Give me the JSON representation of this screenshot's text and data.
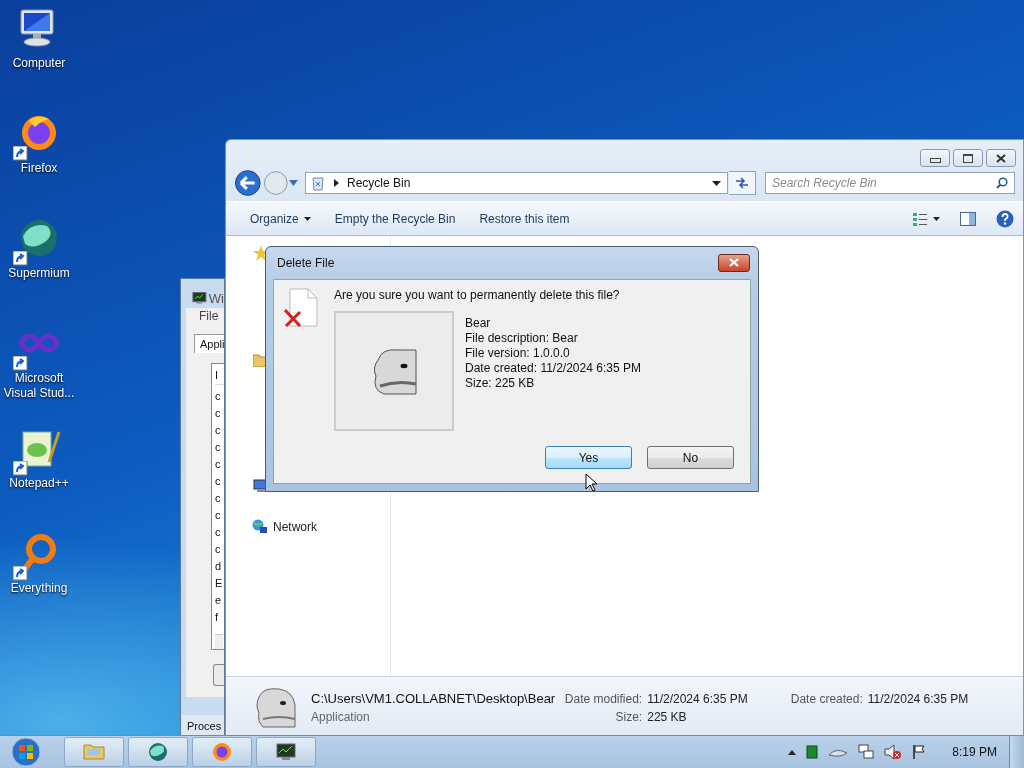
{
  "desktop_icons": [
    {
      "label": "Computer",
      "kind": "computer",
      "shortcut": false
    },
    {
      "label": "Firefox",
      "kind": "firefox",
      "shortcut": true
    },
    {
      "label": "Supermium",
      "kind": "supermium",
      "shortcut": true
    },
    {
      "label": "Microsoft Visual Stud...",
      "kind": "visualstudio",
      "shortcut": true
    },
    {
      "label": "Notepad++",
      "kind": "notepad",
      "shortcut": true
    },
    {
      "label": "Everything",
      "kind": "everything",
      "shortcut": true
    }
  ],
  "background_window": {
    "title": "Wi",
    "menu": [
      "File"
    ],
    "tab": "Appli",
    "list_header": "I",
    "list_rows": [
      "c",
      "c",
      "c",
      "c",
      "c",
      "c",
      "c",
      "c",
      "c",
      "c",
      "d",
      "E",
      "e",
      "f"
    ],
    "status": "Proces"
  },
  "explorer": {
    "address": "Recycle Bin",
    "search": {
      "placeholder": "Search Recycle Bin"
    },
    "toolbar": [
      {
        "label": "Organize",
        "dropdown": true
      },
      {
        "label": "Empty the Recycle Bin",
        "dropdown": false
      },
      {
        "label": "Restore this item",
        "dropdown": false
      }
    ],
    "nav_items": [
      {
        "label": "Network"
      }
    ],
    "details": {
      "path": "C:\\Users\\VM1.COLLABNET\\Desktop\\Bear",
      "type": "Application",
      "fields": [
        {
          "label": "Date modified:",
          "value": "11/2/2024 6:35 PM"
        },
        {
          "label": "Date created:",
          "value": "11/2/2024 6:35 PM"
        },
        {
          "label": "Size:",
          "value": "225 KB"
        }
      ]
    }
  },
  "dialog": {
    "title": "Delete File",
    "question": "Are you sure you want to permanently delete this file?",
    "file_info": [
      "Bear",
      "File description: Bear",
      "File version: 1.0.0.0",
      "Date created: 11/2/2024 6:35 PM",
      "Size: 225 KB"
    ],
    "buttons": [
      {
        "label": "Yes",
        "default": true
      },
      {
        "label": "No",
        "default": false
      }
    ]
  },
  "taskbar": {
    "items": [
      {
        "kind": "explorer"
      },
      {
        "kind": "supermium"
      },
      {
        "kind": "firefox"
      },
      {
        "kind": "taskmanager"
      }
    ],
    "clock": "8:19 PM"
  }
}
